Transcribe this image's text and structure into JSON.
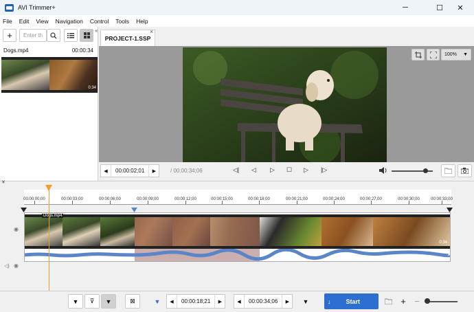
{
  "window": {
    "title": "AVI Trimmer+",
    "minimize": "─",
    "maximize": "☐",
    "close": "✕"
  },
  "menu": [
    "File",
    "Edit",
    "View",
    "Navigation",
    "Control",
    "Tools",
    "Help"
  ],
  "library": {
    "search_placeholder": "Enter th",
    "clip": {
      "name": "Dogs.mp4",
      "duration": "00:00:34",
      "thumb_duration": "0:34"
    }
  },
  "tab": {
    "label": "PROJECT-1.SSP",
    "close": "×"
  },
  "preview": {
    "zoom": "100%"
  },
  "playback": {
    "current": "00:00:02;01",
    "total": "/ 00:00:34;06"
  },
  "timeline": {
    "ticks": [
      "00:00:00;00",
      "00:00:03;00",
      "00:00:06;00",
      "00:00:09;00",
      "00:00:12;00",
      "00:00:15;00",
      "00:00:18;00",
      "00:00:21;00",
      "00:00:24;00",
      "00:00:27;00",
      "00:00:30;00",
      "00:00:33;00"
    ],
    "clip_label": "Dogs.mp4",
    "clip_end": "0:34"
  },
  "bottom": {
    "mark_in": "00:00:18;21",
    "mark_out": "00:00:34;06",
    "start_label": "Start"
  },
  "colors": {
    "accent": "#2c6fd1",
    "selection": "#a87a7a",
    "playhead": "#f0a020",
    "waveform": "#5a85c8"
  }
}
